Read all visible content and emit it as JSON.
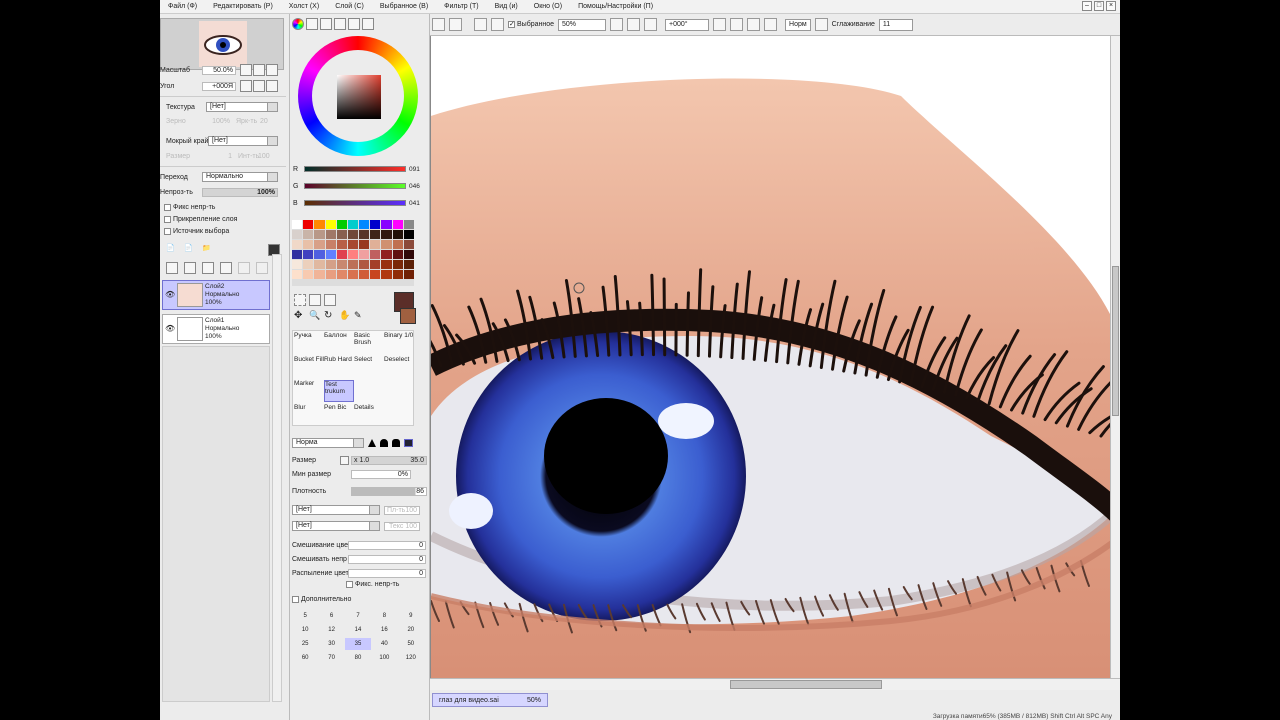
{
  "menu": [
    "Файл (Ф)",
    "Редактировать (Р)",
    "Холст (Х)",
    "Слой (С)",
    "Выбранное (В)",
    "Фильтр (Т)",
    "Вид (и)",
    "Окно (О)",
    "Помощь/Настройки (П)"
  ],
  "navigator": {
    "zoom_label": "Масштаб",
    "zoom_value": "50.0%",
    "angle_label": "Угол",
    "angle_value": "+000Я"
  },
  "texture": {
    "label": "Текстура",
    "value": "[Нет]",
    "grain_label": "Зерно",
    "grain_value": "100%",
    "bright_label": "Ярк-ть",
    "bright_value": "20"
  },
  "wet_edge": {
    "label": "Мокрый край",
    "value": "[Нет]",
    "size_label": "Размер",
    "size_value": "1",
    "intensity_label": "Инт-ть",
    "intensity_value": "100"
  },
  "blend": {
    "label": "Переход",
    "value": "Нормально"
  },
  "opacity": {
    "label": "Непроз-ть",
    "value": "100%"
  },
  "checks": [
    "Фикс непр-ть",
    "Прикрепление слоя",
    "Источник выбора"
  ],
  "layers": [
    {
      "name": "Слой2",
      "mode": "Нормально",
      "opacity": "100%"
    },
    {
      "name": "Слой1",
      "mode": "Нормально",
      "opacity": "100%"
    }
  ],
  "rgb": {
    "r_label": "R",
    "r": "091",
    "g_label": "G",
    "g": "046",
    "b_label": "B",
    "b": "041"
  },
  "colors": {
    "current": "#5b2e29",
    "accent": "#c8c8ff"
  },
  "tools": [
    [
      "Ручка",
      "Баллон",
      "Basic Brush",
      "Binary 1/0"
    ],
    [
      "Bucket Fill",
      "Rub Hard",
      "Select",
      "Deselect"
    ],
    [
      "Marker",
      "Test trukum",
      "",
      ""
    ],
    [
      "Blur",
      "Pen Bic",
      "Details",
      ""
    ]
  ],
  "brush": {
    "mode": "Норма",
    "size_label": "Размер",
    "size_mult": "x 1.0",
    "size_value": "35.0",
    "min_size_label": "Мин размер",
    "min_size_value": "0%",
    "density_label": "Плотность",
    "density_value": "86",
    "shape1": "[Нет]",
    "shape1_aux": "Пл-ть100",
    "shape2": "[Нет]",
    "shape2_aux": "Текс 100",
    "mix_label": "Смешивание цвет",
    "mix_value": "0",
    "mix2_label": "Смешивать непр",
    "mix2_value": "0",
    "spray_label": "Распыление цвет",
    "spray_value": "0",
    "lock_label": "Фикс. непр-ть",
    "extra_label": "Дополнительно"
  },
  "dot_sizes": [
    "5",
    "6",
    "7",
    "8",
    "9",
    "10",
    "12",
    "14",
    "16",
    "20",
    "25",
    "30",
    "35",
    "40",
    "50",
    "60",
    "70",
    "80",
    "100",
    "120"
  ],
  "toolbar": {
    "selection_label": "Выбранное",
    "zoom": "50%",
    "angle": "+000°",
    "mode": "Норм",
    "smooth_label": "Сглаживание",
    "smooth_value": "11"
  },
  "document": {
    "name": "глаз для видео.sai",
    "zoom": "50%"
  },
  "status": "Загрузка памяти65% (385MB / 812MB)  Shift Ctrl Alt SPC Any"
}
